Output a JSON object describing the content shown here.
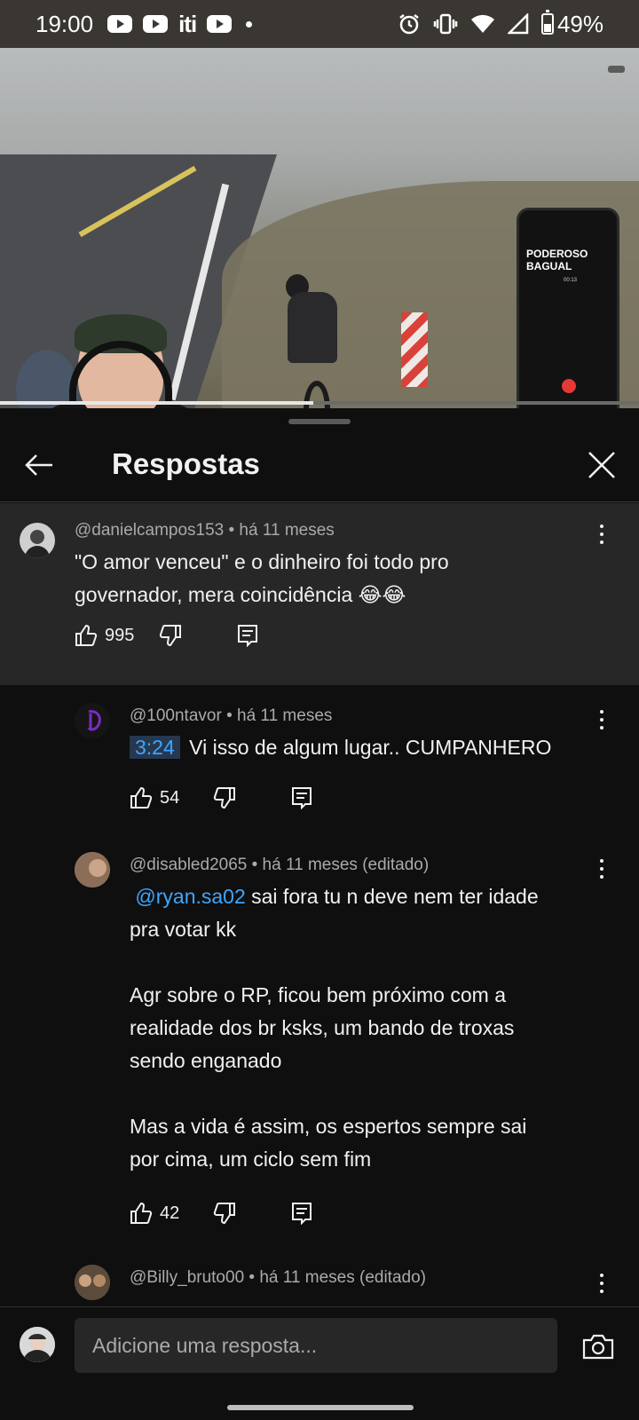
{
  "status_bar": {
    "time": "19:00",
    "app_label": "iti",
    "battery": "49%"
  },
  "video": {
    "overlay_phone_title": "PODEROSO BAGUAL",
    "overlay_phone_time": "00:13",
    "progress_fraction": 0.49
  },
  "sheet": {
    "title": "Respostas"
  },
  "comments": [
    {
      "author_meta": "@danielcampos153 • há 11 meses",
      "text_line1": "\"O amor venceu\" e o dinheiro foi todo pro",
      "text_line2": "governador, mera coincidência 😂😂",
      "likes": "995"
    },
    {
      "author_meta": "@100ntavor • há 11 meses",
      "timestamp": "3:24",
      "text": "Vi isso de algum lugar.. CUMPANHERO",
      "likes": "54"
    },
    {
      "author_meta": "@disabled2065 • há 11 meses (editado)",
      "mention": "@ryan.sa02",
      "text_line1_rest": "sai fora tu n deve nem ter idade",
      "text_line2": "pra votar kk",
      "text_line3": "Agr sobre o RP, ficou bem próximo com a",
      "text_line4": "realidade dos br ksks, um bando de troxas",
      "text_line5": "sendo enganado",
      "text_line6": "Mas a vida é assim, os espertos sempre sai",
      "text_line7": "por cima, um ciclo sem fim",
      "likes": "42"
    },
    {
      "author_meta": "@Billy_bruto00 • há 11 meses (editado)"
    }
  ],
  "compose": {
    "placeholder": "Adicione uma resposta..."
  }
}
